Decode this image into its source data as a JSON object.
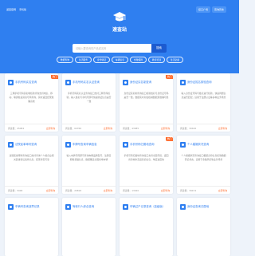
{
  "header": {
    "nav_links": [
      "返回官网",
      "手机版"
    ],
    "nav_buttons": [
      "接口广场",
      "查询历史"
    ],
    "site_name": "速查站",
    "search": {
      "placeholder": "请输入要查询的产品或名称",
      "button": "搜索"
    },
    "categories": [
      "数据查询",
      "生活服务",
      "身份验证",
      "车辆信息",
      "金融保险",
      "教育培训",
      "生活必备"
    ]
  },
  "colors": {
    "brand": "#2f7ff0",
    "accent": "#ff6b2c"
  },
  "cards": [
    {
      "title": "手机号码实名查询",
      "badge": "热门",
      "desc": "三网手机号码实名制核验查询支持电信、移动、联通各运营商号码查询，实时返回结果准确高效",
      "views_label": "阅读量",
      "views": "45084",
      "action": "立即查询",
      "icon": "phone-icon"
    },
    {
      "title": "手机号码实名认证查询",
      "badge": "",
      "desc": "手机号码实名认证查询接口支持三网号码核验，输入姓名与手机号即可快速验证信息是否一致",
      "views_label": "阅读量",
      "views": "64766",
      "action": "立即查询",
      "icon": "id-card-icon"
    },
    {
      "title": "身份证实名制查询",
      "badge": "热门",
      "desc": "身份证实名制查询接口核验姓名与身份证号码是否一致，数据实时对接权威数据源准确可靠",
      "views_label": "阅读量",
      "views": "43085",
      "action": "立即查询",
      "icon": "user-icon"
    },
    {
      "title": "身份证姓名核验查询",
      "badge": "",
      "desc": "输入身份证号码与姓名进行核验，快速判断信息是否匹配，适用于注册认证等多种业务场景",
      "views_label": "阅读量",
      "views": "30426",
      "action": "立即查询",
      "icon": "shield-icon"
    },
    {
      "title": "法院民事审判查询",
      "badge": "",
      "desc": "法院民事审判查询接口支持查询个人或企业相关民事诉讼案件信息，结果详实可靠",
      "views_label": "阅读量",
      "views": "5048",
      "action": "立即查询",
      "icon": "court-icon"
    },
    {
      "title": "车牌号查询车辆信息",
      "badge": "",
      "desc": "输入车牌号码即可查询车辆品牌型号、注册日期等基础信息，数据覆盖全国各地车辆",
      "views_label": "阅读量",
      "views": "20818",
      "action": "立即查询",
      "icon": "car-icon"
    },
    {
      "title": "手机号码归属地查询",
      "badge": "热门",
      "desc": "手机号码归属地查询接口支持全国号段，返回省份城市及运营商信息，响应速度快",
      "views_label": "阅读量",
      "views": "13020",
      "action": "立即查询",
      "icon": "location-icon"
    },
    {
      "title": "个人婚姻状况查询",
      "badge": "",
      "desc": "个人婚姻状况查询接口根据身份信息核验婚姻登记状态，适用于金融风控等业务场景",
      "views_label": "阅读量",
      "views": "39474",
      "action": "立即查询",
      "icon": "heart-icon"
    },
    {
      "title": "车辆号查询违章记录",
      "badge": "",
      "desc": "",
      "views_label": "",
      "views": "",
      "action": "",
      "icon": "car-icon"
    },
    {
      "title": "驾驶行人综合查询",
      "badge": "",
      "desc": "",
      "views_label": "",
      "views": "",
      "action": "",
      "icon": "license-icon"
    },
    {
      "title": "车辆过户记录查询（高级版）",
      "badge": "",
      "desc": "",
      "views_label": "",
      "views": "",
      "action": "",
      "icon": "transfer-icon"
    },
    {
      "title": "身份证查询归属地",
      "badge": "",
      "desc": "",
      "views_label": "",
      "views": "",
      "action": "",
      "icon": "map-icon"
    }
  ]
}
